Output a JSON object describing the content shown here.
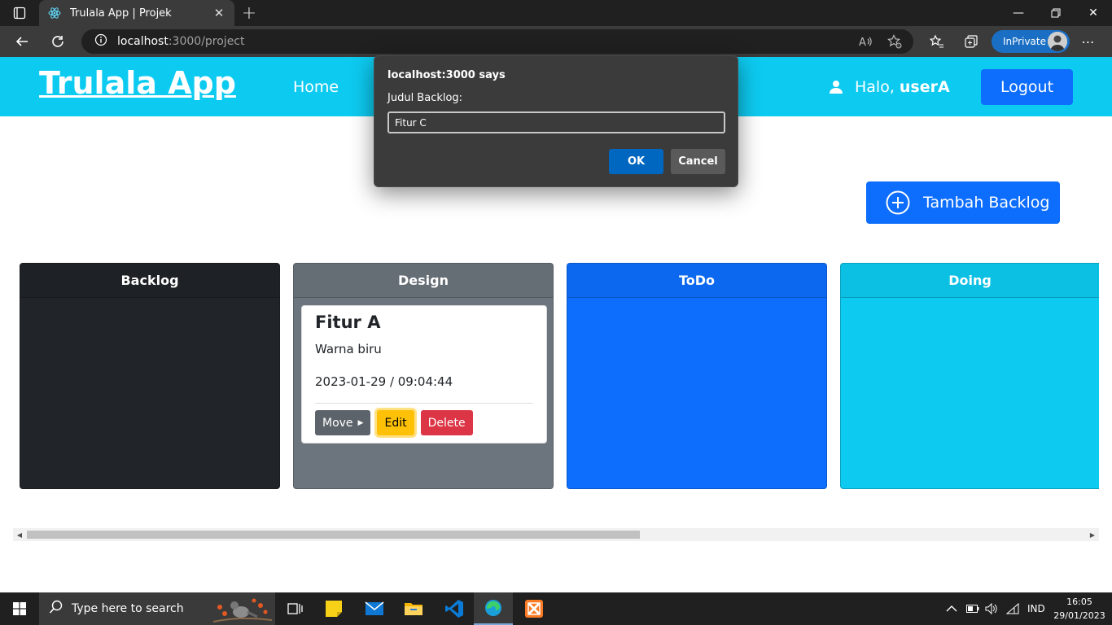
{
  "browser": {
    "tab_title": "Trulala App | Projek",
    "url_host": "localhost",
    "url_path": ":3000/project",
    "inprivate_label": "InPrivate"
  },
  "app": {
    "brand": "Trulala App",
    "nav_home": "Home",
    "greeting": "Halo,",
    "username": "userA",
    "logout_label": "Logout",
    "add_backlog_label": "Tambah Backlog"
  },
  "columns": [
    {
      "title": "Backlog",
      "color": "#212529"
    },
    {
      "title": "Design",
      "color": "#6c757d"
    },
    {
      "title": "ToDo",
      "color": "#0d6efd"
    },
    {
      "title": "Doing",
      "color": "#0dcaf0"
    }
  ],
  "card": {
    "title": "Fitur A",
    "description": "Warna biru",
    "datetime": "2023-01-29 / 09:04:44",
    "move_label": "Move",
    "edit_label": "Edit",
    "delete_label": "Delete"
  },
  "dialog": {
    "title": "localhost:3000 says",
    "message": "Judul Backlog:",
    "input_value": "Fitur C",
    "ok_label": "OK",
    "cancel_label": "Cancel"
  },
  "taskbar": {
    "search_placeholder": "Type here to search",
    "language": "IND",
    "time": "16:05",
    "date": "29/01/2023"
  },
  "colors": {
    "header": "#0dcaf0",
    "primary": "#0d6efd",
    "warning": "#ffc107",
    "danger": "#dc3545"
  }
}
